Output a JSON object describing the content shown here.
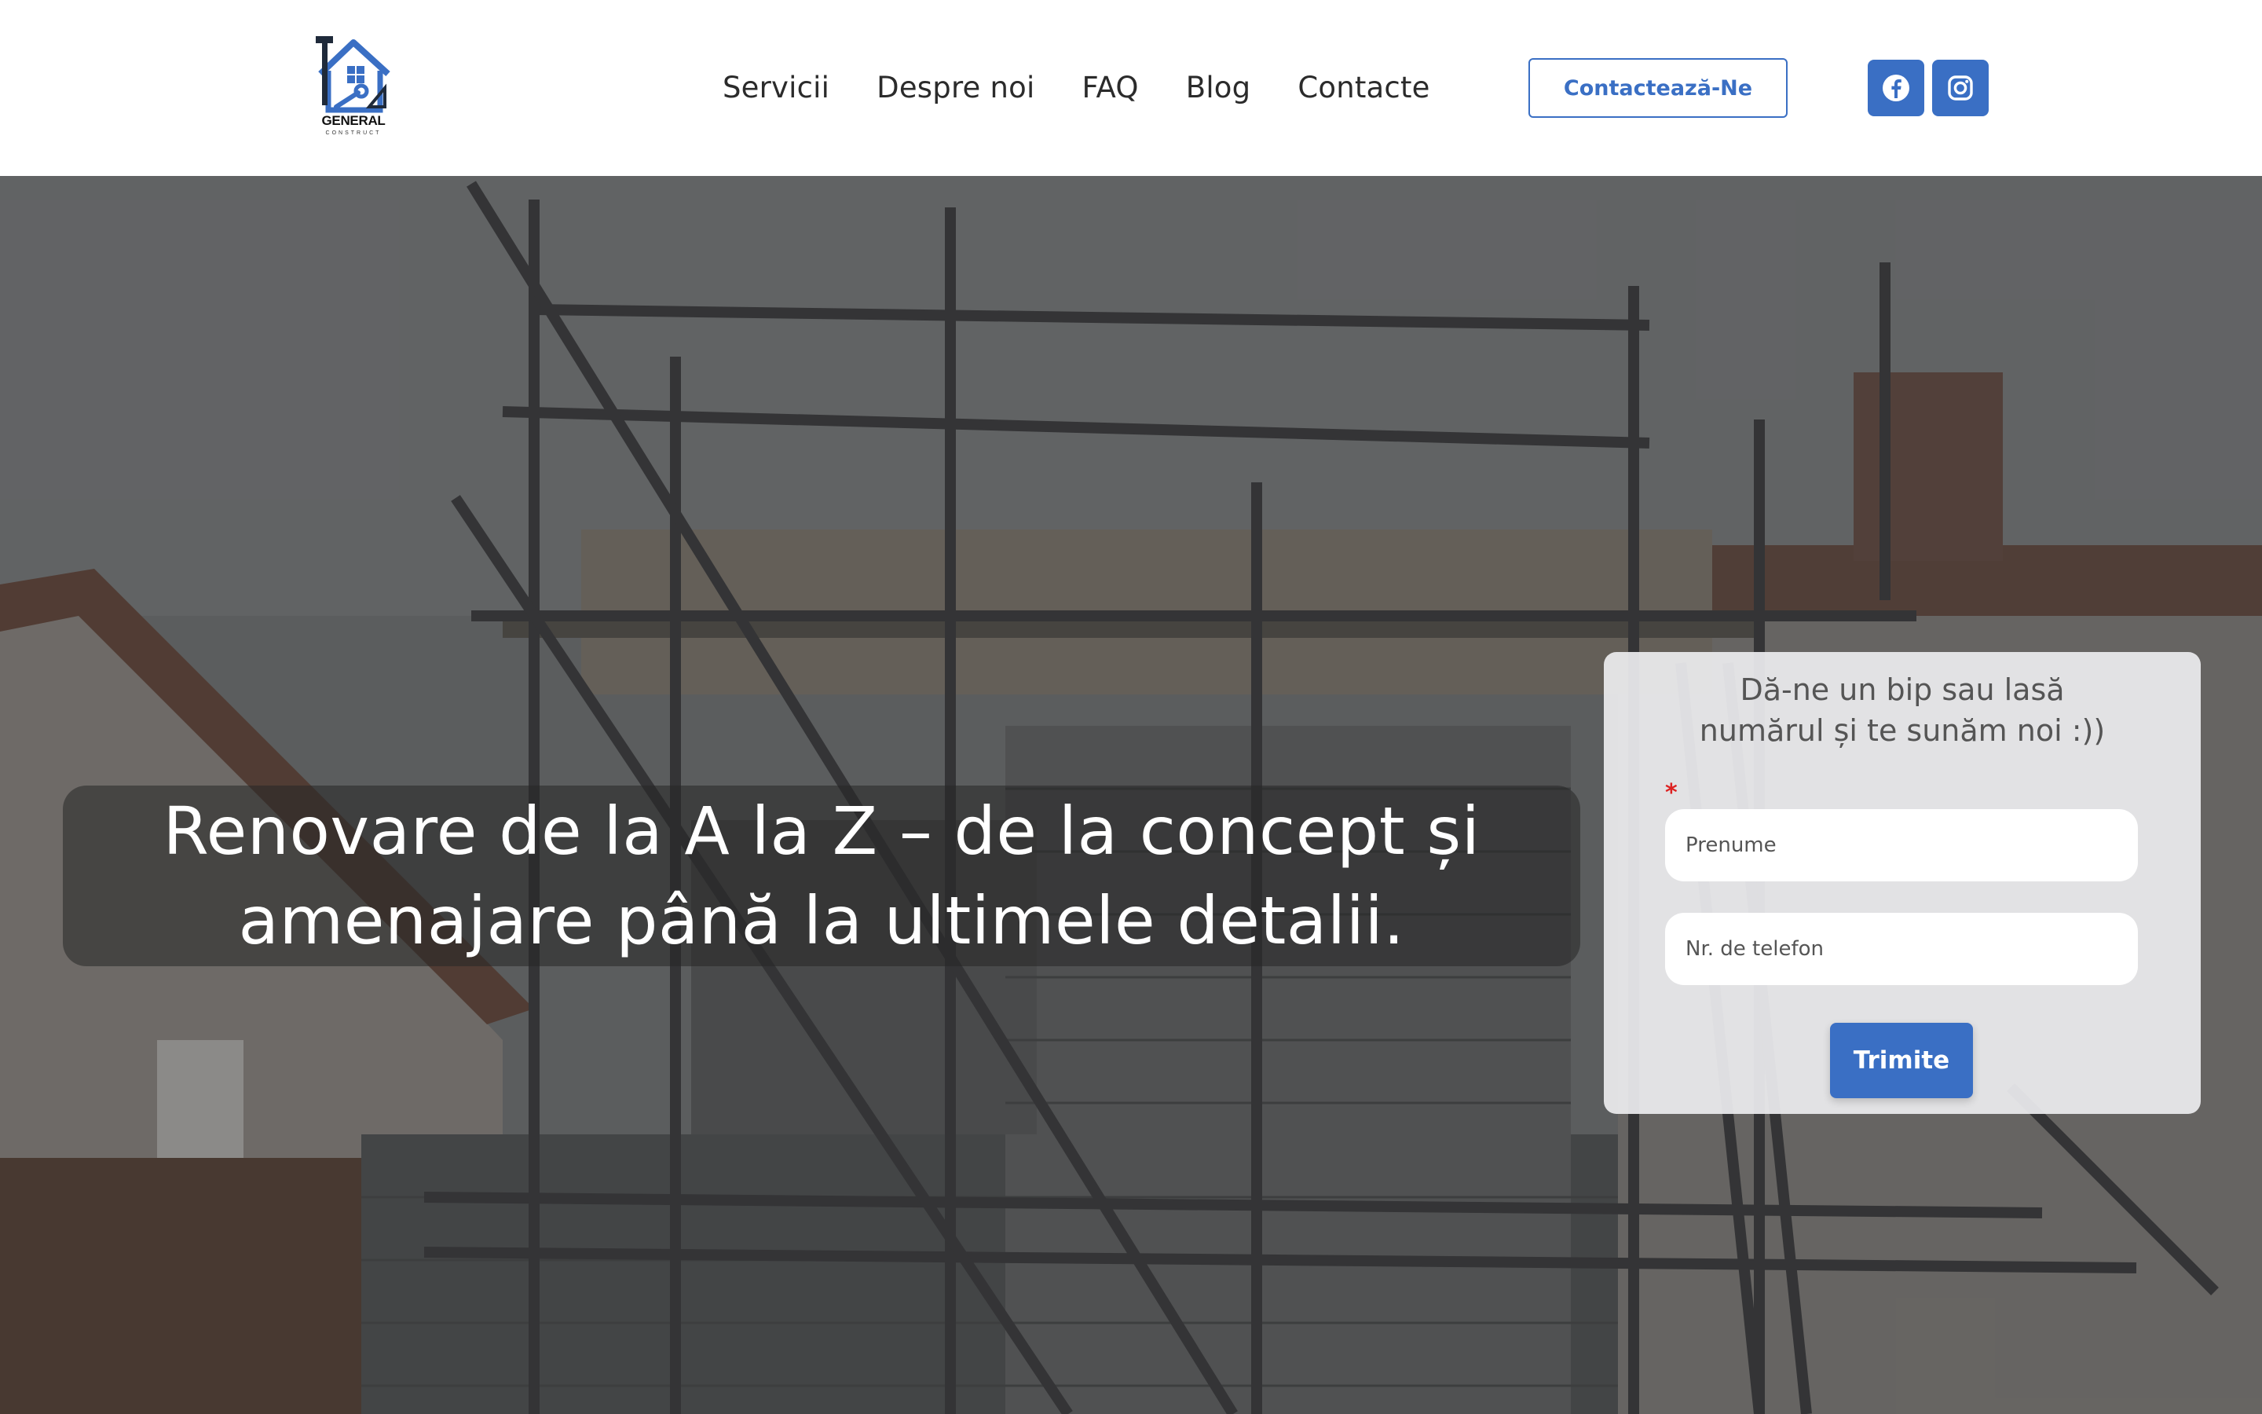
{
  "brand": {
    "name": "GENERAL",
    "tagline": "CONSTRUCT"
  },
  "nav": {
    "items": [
      "Servicii",
      "Despre noi",
      "FAQ",
      "Blog",
      "Contacte"
    ]
  },
  "header": {
    "cta_label": "Contactează-Ne",
    "social": [
      "facebook-icon",
      "instagram-icon"
    ]
  },
  "hero": {
    "headline_line1": "Renovare de la A la Z – de la concept și",
    "headline_line2": "amenajare până la ultimele detalii."
  },
  "form": {
    "title_line1": "Dă-ne un bip sau lasă",
    "title_line2": "numărul și te sunăm noi :))",
    "required_mark": "*",
    "name_placeholder": "Prenume",
    "phone_placeholder": "Nr. de telefon",
    "submit_label": "Trimite"
  },
  "colors": {
    "accent": "#3a6fc4",
    "text_dark": "#2b2b2b",
    "required": "#dd2222"
  }
}
